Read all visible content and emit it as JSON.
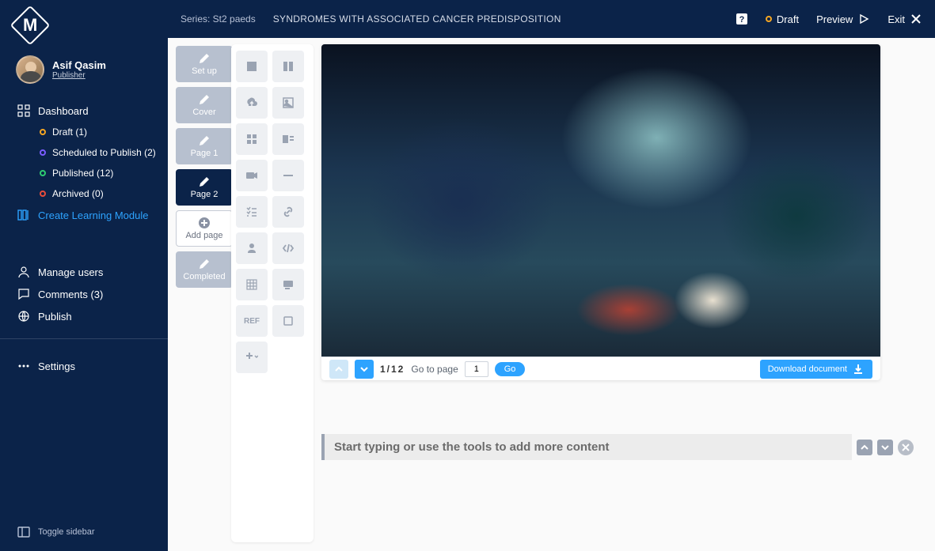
{
  "sidebar": {
    "logo_letter": "M",
    "user_name": "Asif Qasim",
    "user_role": "Publisher",
    "dashboard_label": "Dashboard",
    "items": [
      {
        "label": "Draft (1)",
        "dot": "#f5a623"
      },
      {
        "label": "Scheduled to Publish (2)",
        "dot": "#7b5cff"
      },
      {
        "label": "Published (12)",
        "dot": "#2ecc71"
      },
      {
        "label": "Archived (0)",
        "dot": "#e74c3c"
      }
    ],
    "create_label": "Create Learning Module",
    "manage_users": "Manage users",
    "comments": "Comments (3)",
    "publish": "Publish",
    "settings": "Settings",
    "toggle": "Toggle sidebar"
  },
  "topbar": {
    "series": "Series: St2 paeds",
    "title": "SYNDROMES WITH ASSOCIATED CANCER PREDISPOSITION",
    "draft": "Draft",
    "preview": "Preview",
    "exit": "Exit"
  },
  "pages": {
    "setup": "Set up",
    "cover": "Cover",
    "p1": "Page 1",
    "p2": "Page 2",
    "add": "Add page",
    "completed": "Completed"
  },
  "tools": {
    "ref": "REF"
  },
  "docbar": {
    "counter": "1/12",
    "goto": "Go to page",
    "page_value": "1",
    "go": "Go",
    "download": "Download document"
  },
  "typing": {
    "placeholder": "Start typing or use the tools to add more content"
  }
}
